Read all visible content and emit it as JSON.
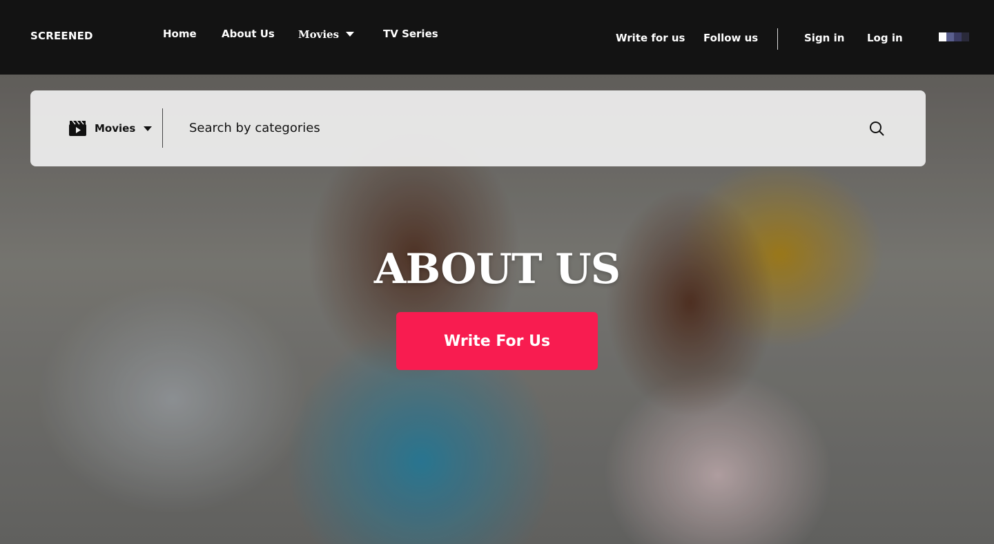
{
  "header": {
    "brand": "SCREENED",
    "nav": {
      "home": "Home",
      "about": "About Us",
      "movies": "Movies",
      "tv_series": "TV Series"
    },
    "right": {
      "write": "Write for us",
      "follow": "Follow us",
      "sign_in": "Sign in",
      "log_in": "Log in"
    },
    "flag_colors": [
      "#ffffff",
      "#5a5f8e",
      "#3b3c63",
      "#2a2a3a"
    ]
  },
  "search": {
    "category": "Movies",
    "placeholder": "Search by categories",
    "icon": "search-icon",
    "category_icon": "clapperboard-icon"
  },
  "hero": {
    "title": "ABOUT US",
    "cta_label": "Write For Us",
    "cta_color": "#f81c50"
  }
}
